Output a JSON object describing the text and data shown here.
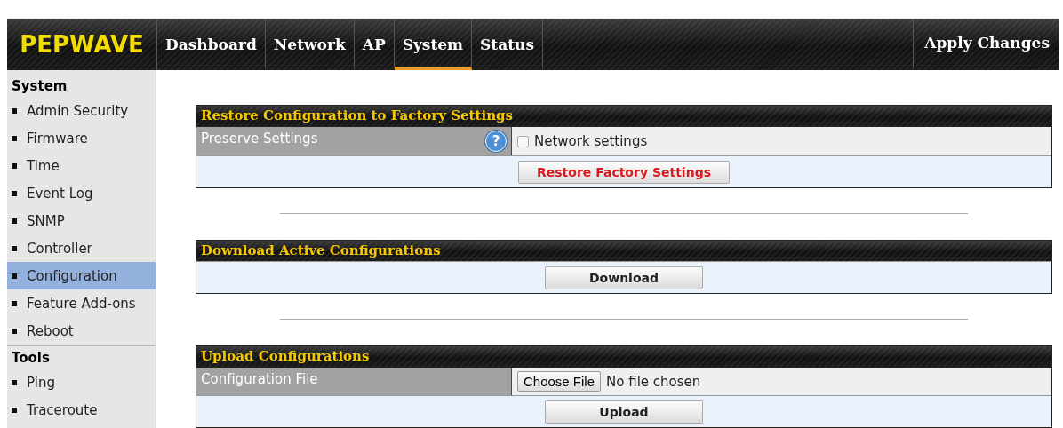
{
  "nav": {
    "logo": "PEPWAVE",
    "tabs": [
      {
        "label": "Dashboard",
        "selected": false
      },
      {
        "label": "Network",
        "selected": false
      },
      {
        "label": "AP",
        "selected": false
      },
      {
        "label": "System",
        "selected": true
      },
      {
        "label": "Status",
        "selected": false
      }
    ],
    "apply": "Apply Changes"
  },
  "sidebar": [
    {
      "title": "System",
      "items": [
        {
          "label": "Admin Security",
          "selected": false
        },
        {
          "label": "Firmware",
          "selected": false
        },
        {
          "label": "Time",
          "selected": false
        },
        {
          "label": "Event Log",
          "selected": false
        },
        {
          "label": "SNMP",
          "selected": false
        },
        {
          "label": "Controller",
          "selected": false
        },
        {
          "label": "Configuration",
          "selected": true
        },
        {
          "label": "Feature Add-ons",
          "selected": false
        },
        {
          "label": "Reboot",
          "selected": false
        }
      ]
    },
    {
      "title": "Tools",
      "items": [
        {
          "label": "Ping",
          "selected": false
        },
        {
          "label": "Traceroute",
          "selected": false
        }
      ]
    }
  ],
  "sections": [
    {
      "title": "Restore Configuration to Factory Settings",
      "rows": [
        {
          "kind": "checkbox",
          "label": "Preserve Settings",
          "help": "?",
          "option": "Network settings",
          "checked": false
        },
        {
          "kind": "action",
          "button": "Restore Factory Settings",
          "warning": true
        }
      ]
    },
    {
      "title": "Download Active Configurations",
      "rows": [
        {
          "kind": "action",
          "button": "Download",
          "warning": false
        }
      ]
    },
    {
      "title": "Upload Configurations",
      "rows": [
        {
          "kind": "file",
          "label": "Configuration File",
          "button": "Choose File",
          "status": "No file chosen"
        },
        {
          "kind": "action",
          "button": "Upload",
          "warning": false
        }
      ]
    }
  ]
}
